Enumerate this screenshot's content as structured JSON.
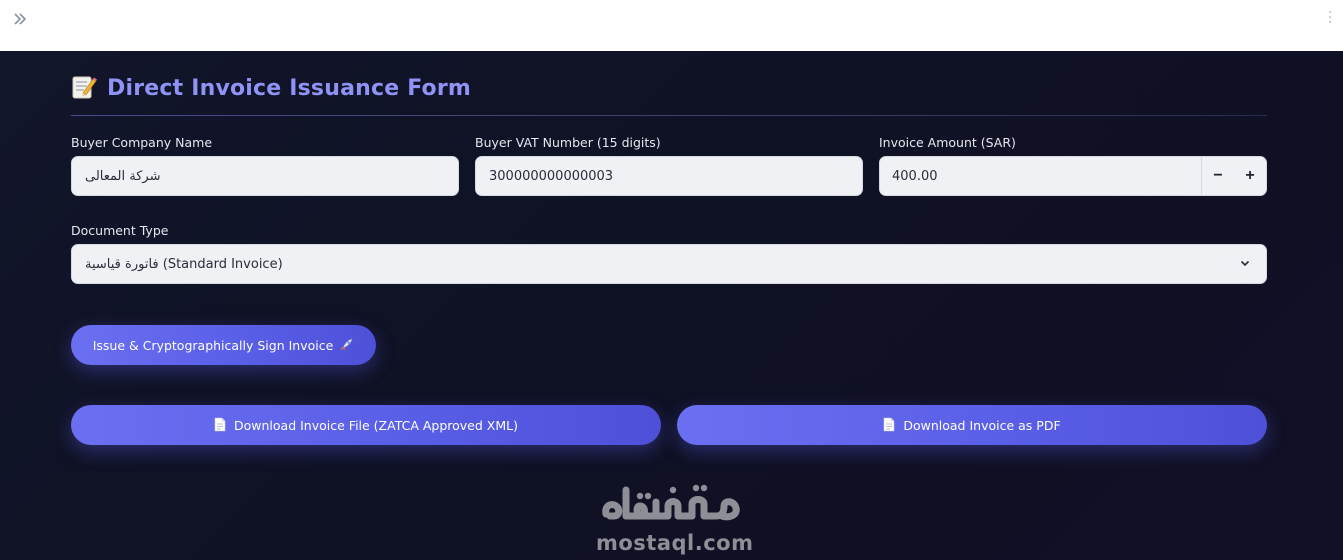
{
  "form": {
    "title": "Direct Invoice Issuance Form",
    "title_icon": "memo-icon",
    "buyer_company": {
      "label": "Buyer Company Name",
      "value": "شركة المعالى"
    },
    "buyer_vat": {
      "label": "Buyer VAT Number (15 digits)",
      "value": "300000000000003"
    },
    "invoice_amount": {
      "label": "Invoice Amount (SAR)",
      "value": "400.00",
      "decrement": "−",
      "increment": "+"
    },
    "document_type": {
      "label": "Document Type",
      "selected": "فاتورة قياسية (Standard Invoice)"
    }
  },
  "actions": {
    "issue_label": "Issue & Cryptographically Sign Invoice",
    "issue_icon": "rocket-icon",
    "download_xml_label": "Download Invoice File (ZATCA Approved XML)",
    "download_pdf_label": "Download Invoice as PDF",
    "download_icon": "document-icon"
  },
  "watermark": {
    "text": "mostaql.com"
  },
  "colors": {
    "accent": "#5a5fe8",
    "title": "#8e93f5",
    "background": "#11142a"
  }
}
